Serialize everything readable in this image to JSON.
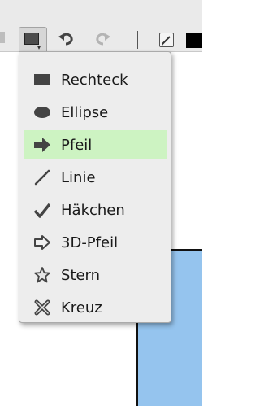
{
  "toolbar": {
    "shape_button_icon": "rectangle-icon",
    "undo_icon": "undo-icon",
    "redo_icon": "redo-icon",
    "pen_icon": "pen-icon",
    "current_color": "#000000"
  },
  "menu": {
    "selected_index": 2,
    "items": [
      {
        "label": "Rechteck",
        "icon": "rectangle-icon"
      },
      {
        "label": "Ellipse",
        "icon": "ellipse-icon"
      },
      {
        "label": "Pfeil",
        "icon": "arrow-icon"
      },
      {
        "label": "Linie",
        "icon": "line-icon"
      },
      {
        "label": "Häkchen",
        "icon": "checkmark-icon"
      },
      {
        "label": "3D-Pfeil",
        "icon": "3d-arrow-icon"
      },
      {
        "label": "Stern",
        "icon": "star-icon"
      },
      {
        "label": "Kreuz",
        "icon": "cross-icon"
      }
    ]
  },
  "colors": {
    "selected_highlight": "#cdf3c2",
    "canvas_shape_fill": "#95c4ee"
  }
}
